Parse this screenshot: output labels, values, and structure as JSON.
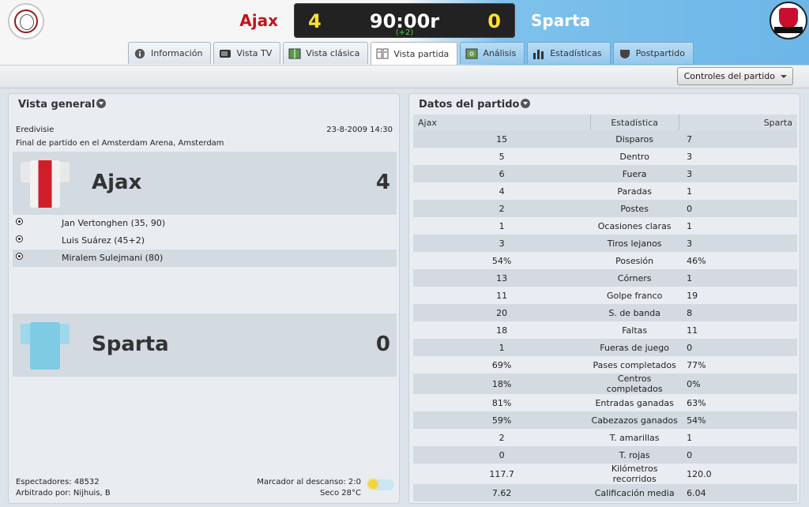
{
  "header": {
    "home_team": "Ajax",
    "away_team": "Sparta",
    "home_score": "4",
    "away_score": "0",
    "clock": "90:00r",
    "added_time": "(+2)",
    "colors": {
      "home_name": "#c4131b",
      "score": "#ffe12b",
      "added": "#4fd04f"
    }
  },
  "tabs": [
    {
      "label": "Información",
      "icon": "info-icon",
      "active": false
    },
    {
      "label": "Vista TV",
      "icon": "tv-icon",
      "active": false
    },
    {
      "label": "Vista clásica",
      "icon": "pitch-icon",
      "active": false
    },
    {
      "label": "Vista partida",
      "icon": "split-view-icon",
      "active": true
    },
    {
      "label": "Análisis",
      "icon": "analysis-icon",
      "active": false
    },
    {
      "label": "Estadísticas",
      "icon": "bar-chart-icon",
      "active": false
    },
    {
      "label": "Postpartido",
      "icon": "shield-icon",
      "active": false
    }
  ],
  "toolbar": {
    "match_controls": "Controles del partido"
  },
  "overview": {
    "title": "Vista general",
    "competition": "Eredivisie",
    "datetime": "23-8-2009 14:30",
    "venue": "Final de partido en el Amsterdam Arena, Amsterdam",
    "home": {
      "name": "Ajax",
      "score": "4",
      "scorers": [
        "Jan Vertonghen (35, 90)",
        "Luis Suárez (45+2)",
        "Miralem Sulejmani (80)"
      ]
    },
    "away": {
      "name": "Sparta",
      "score": "0"
    },
    "attendance": "Espectadores: 48532",
    "referee": "Arbitrado por: Nijhuis, B",
    "halftime": "Marcador al descanso: 2:0",
    "weather": "Seco 28°C",
    "weather_icon": "sun-icon"
  },
  "match_stats": {
    "title": "Datos del partido",
    "headers": [
      "Ajax",
      "Estadística",
      "Sparta"
    ],
    "rows": [
      [
        "15",
        "Disparos",
        "7"
      ],
      [
        "5",
        "Dentro",
        "3"
      ],
      [
        "6",
        "Fuera",
        "3"
      ],
      [
        "4",
        "Paradas",
        "1"
      ],
      [
        "2",
        "Postes",
        "0"
      ],
      [
        "1",
        "Ocasiones claras",
        "1"
      ],
      [
        "3",
        "Tiros lejanos",
        "3"
      ],
      [
        "54%",
        "Posesión",
        "46%"
      ],
      [
        "13",
        "Córners",
        "1"
      ],
      [
        "11",
        "Golpe franco",
        "19"
      ],
      [
        "20",
        "S. de banda",
        "8"
      ],
      [
        "18",
        "Faltas",
        "11"
      ],
      [
        "1",
        "Fueras de juego",
        "0"
      ],
      [
        "69%",
        "Pases completados",
        "77%"
      ],
      [
        "18%",
        "Centros completados",
        "0%"
      ],
      [
        "81%",
        "Entradas ganadas",
        "63%"
      ],
      [
        "59%",
        "Cabezazos ganados",
        "54%"
      ],
      [
        "2",
        "T. amarillas",
        "1"
      ],
      [
        "0",
        "T. rojas",
        "0"
      ],
      [
        "117.7",
        "Kilómetros recorridos",
        "120.0"
      ],
      [
        "7.62",
        "Calificación media",
        "6.04"
      ]
    ]
  }
}
